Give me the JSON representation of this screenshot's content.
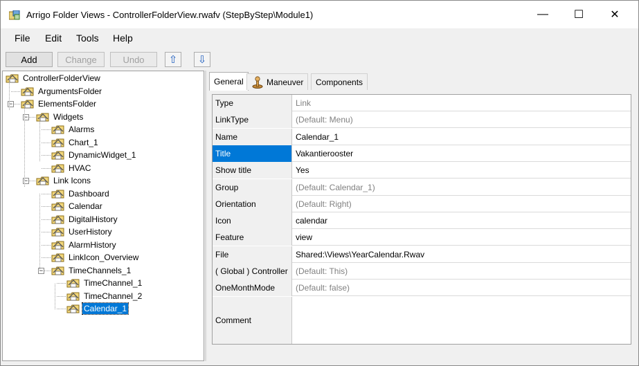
{
  "window": {
    "title": "Arrigo Folder Views - ControllerFolderView.rwafv (StepByStep\\Module1)",
    "minimize": "—",
    "maximize": "☐",
    "close": "✕"
  },
  "menu": {
    "file": "File",
    "edit": "Edit",
    "tools": "Tools",
    "help": "Help"
  },
  "toolbar": {
    "add": "Add",
    "change": "Change",
    "undo": "Undo",
    "up": "⇧",
    "down": "⇩"
  },
  "tree": [
    {
      "label": "ControllerFolderView",
      "level": 0
    },
    {
      "label": "ArgumentsFolder",
      "level": 1
    },
    {
      "label": "ElementsFolder",
      "level": 1
    },
    {
      "label": "Widgets",
      "level": 2
    },
    {
      "label": "Alarms",
      "level": 3
    },
    {
      "label": "Chart_1",
      "level": 3
    },
    {
      "label": "DynamicWidget_1",
      "level": 3
    },
    {
      "label": "HVAC",
      "level": 3
    },
    {
      "label": "Link Icons",
      "level": 2
    },
    {
      "label": "Dashboard",
      "level": 3
    },
    {
      "label": "Calendar",
      "level": 3
    },
    {
      "label": "DigitalHistory",
      "level": 3
    },
    {
      "label": "UserHistory",
      "level": 3
    },
    {
      "label": "AlarmHistory",
      "level": 3
    },
    {
      "label": "LinkIcon_Overview",
      "level": 3
    },
    {
      "label": "TimeChannels_1",
      "level": 3
    },
    {
      "label": "TimeChannel_1",
      "level": 4
    },
    {
      "label": "TimeChannel_2",
      "level": 4
    },
    {
      "label": "Calendar_1",
      "level": 4
    }
  ],
  "tabs": {
    "general": "General",
    "maneuver": "Maneuver",
    "components": "Components"
  },
  "properties": [
    {
      "key": "Type",
      "value": "Link"
    },
    {
      "key": "LinkType",
      "value": "(Default: Menu)"
    },
    {
      "key": "Name",
      "value": "Calendar_1"
    },
    {
      "key": "Title",
      "value": "Vakantierooster"
    },
    {
      "key": "Show title",
      "value": "Yes"
    },
    {
      "key": "Group",
      "value": "(Default: Calendar_1)"
    },
    {
      "key": "Orientation",
      "value": "(Default: Right)"
    },
    {
      "key": "Icon",
      "value": "calendar"
    },
    {
      "key": "Feature",
      "value": "view"
    },
    {
      "key": "File",
      "value": "Shared:\\Views\\YearCalendar.Rwav"
    },
    {
      "key": "( Global ) Controller",
      "value": "(Default: This)"
    },
    {
      "key": "OneMonthMode",
      "value": "(Default: false)"
    },
    {
      "key": "Comment",
      "value": ""
    }
  ]
}
